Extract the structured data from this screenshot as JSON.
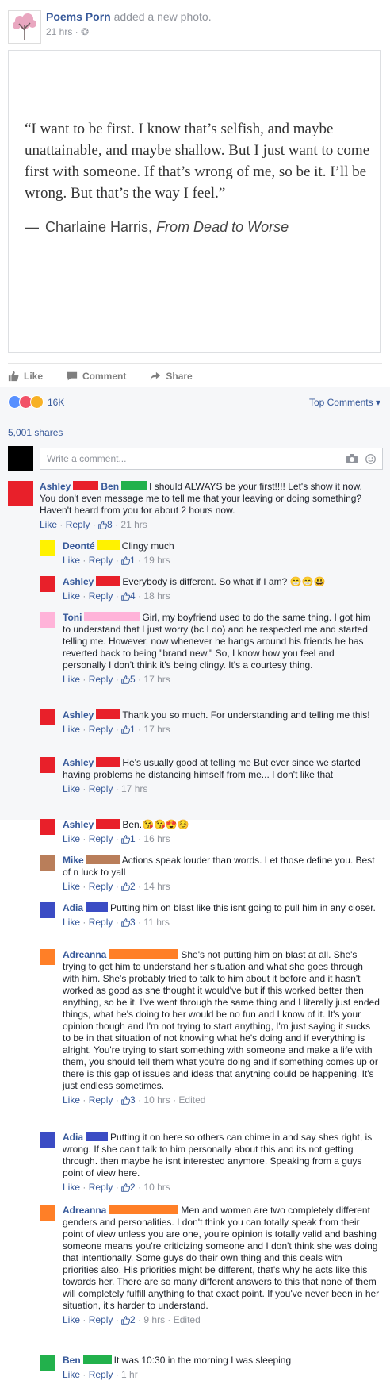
{
  "post": {
    "page_name": "Poems Porn",
    "action": "added a new photo.",
    "time": "21 hrs · ❂"
  },
  "photo": {
    "quote": "“I want to be first. I know that’s selfish, and maybe unattainable, and maybe shallow. But I just want to come first with someone. If that’s wrong of me, so be it. I’ll be wrong. But that’s the way I feel.”",
    "dash": "—",
    "author": "Charlaine Harris",
    "sep": ", ",
    "book": "From Dead to Worse"
  },
  "actions": {
    "like": "Like",
    "comment": "Comment",
    "share": "Share"
  },
  "reactions": {
    "count": "16K",
    "top_comments": "Top Comments ▾",
    "shares": "5,001 shares"
  },
  "write": {
    "placeholder": "Write a comment..."
  },
  "comments": [
    {
      "name": "Ashley",
      "tag": "Ben",
      "text": "I should ALWAYS be your first!!!! Let's show it now. You don't even message me to tell me that your leaving or doing something? Haven't heard from you for about 2 hours now.",
      "meta_like": "Like",
      "meta_reply": "Reply",
      "likes": "8",
      "time": "21 hrs"
    },
    {
      "name": "Deonté",
      "text": "Clingy much",
      "meta_like": "Like",
      "meta_reply": "Reply",
      "likes": "1",
      "time": "19 hrs"
    },
    {
      "name": "Ashley",
      "text": "Everybody is different. So what if I am? 😁😁😃",
      "meta_like": "Like",
      "meta_reply": "Reply",
      "likes": "4",
      "time": "18 hrs"
    },
    {
      "name": "Toni",
      "text": "Girl, my boyfriend used to do the same thing. I got him to understand that I just worry (bc I do) and he respected me and started telling me. However, now whenever he hangs around his friends he has reverted back to being \"brand new.\" So, I know how you feel and personally I don't think it's being clingy. It's a courtesy thing.",
      "meta_like": "Like",
      "meta_reply": "Reply",
      "likes": "5",
      "time": "17 hrs"
    },
    {
      "name": "Ashley",
      "text": "Thank you so much. For understanding and telling me this!",
      "meta_like": "Like",
      "meta_reply": "Reply",
      "likes": "1",
      "time": "17 hrs"
    },
    {
      "name": "Ashley",
      "text": "He's usually good at telling me But ever since we started having problems he distancing himself from me... I don't like that",
      "meta_like": "Like",
      "meta_reply": "Reply",
      "likes": "",
      "time": "17 hrs"
    },
    {
      "name": "Ashley",
      "text": "Ben.😘😘😍☺️",
      "meta_like": "Like",
      "meta_reply": "Reply",
      "likes": "1",
      "time": "16 hrs"
    },
    {
      "name": "Mike",
      "text": "Actions speak louder than words. Let those define you. Best of n luck to yall",
      "meta_like": "Like",
      "meta_reply": "Reply",
      "likes": "2",
      "time": "14 hrs"
    },
    {
      "name": "Adia",
      "text": "Putting him on blast like this isnt going to pull him in any closer.",
      "meta_like": "Like",
      "meta_reply": "Reply",
      "likes": "3",
      "time": "11 hrs"
    },
    {
      "name": "Adreanna",
      "text": "She's not putting him on blast at all. She's trying to get him to understand her situation and what she goes through with him. She's probably tried to talk to him about it before and it hasn't worked as good as she thought it would've but if this worked better then anything, so be it. I've went through the same thing and I literally just ended things, what he's doing to her would be no fun and I know of it. It's your opinion though and I'm not trying to start anything, I'm just saying it sucks to be in that situation of not knowing what he's doing and if everything is alright. You're trying to start something with someone and make a life with them, you should tell them what you're doing and if something comes up or there is this gap of issues and ideas that anything could be happening. It's just endless sometimes.",
      "meta_like": "Like",
      "meta_reply": "Reply",
      "likes": "3",
      "time": "10 hrs · Edited"
    },
    {
      "name": "Adia",
      "text": "Putting it on here so others can chime in and say shes right, is wrong. If she can't talk to him personally about this and its not getting through. then maybe he isnt interested anymore. Speaking from a guys point of view here.",
      "meta_like": "Like",
      "meta_reply": "Reply",
      "likes": "2",
      "time": "10 hrs"
    },
    {
      "name": "Adreanna",
      "text": "Men and women are two completely different genders and personalities. I don't think you can totally speak from their point of view unless you are one, you're opinion is totally valid and bashing someone means you're criticizing someone and I don't think she was doing that intentionally. Some guys do their own thing and this deals with priorities also. His priorities might be different, that's why he acts like this towards her. There are so many different answers to this that none of them will completely fulfill anything to that exact point. If you've never been in her situation, it's harder to understand.",
      "meta_like": "Like",
      "meta_reply": "Reply",
      "likes": "2",
      "time": "9 hrs · Edited"
    },
    {
      "name": "Ben",
      "text": "It was 10:30 in the morning I was sleeping",
      "meta_like": "Like",
      "meta_reply": "Reply",
      "likes": "",
      "time": "1 hr"
    }
  ]
}
